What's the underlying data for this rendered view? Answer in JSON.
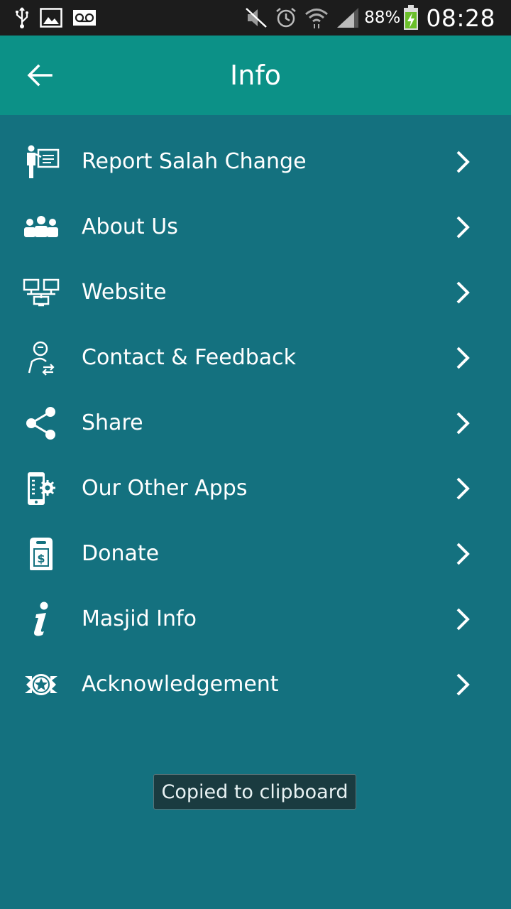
{
  "status_bar": {
    "battery_percent": "88%",
    "time": "08:28"
  },
  "app_bar": {
    "title": "Info",
    "back_icon": "arrow-left-icon"
  },
  "menu": {
    "items": [
      {
        "label": "Report Salah Change",
        "icon": "presenter-board-icon"
      },
      {
        "label": "About Us",
        "icon": "group-people-icon"
      },
      {
        "label": "Website",
        "icon": "network-monitors-icon"
      },
      {
        "label": "Contact & Feedback",
        "icon": "person-exchange-icon"
      },
      {
        "label": "Share",
        "icon": "share-icon"
      },
      {
        "label": "Our Other Apps",
        "icon": "phone-gear-icon"
      },
      {
        "label": "Donate",
        "icon": "donation-box-icon"
      },
      {
        "label": "Masjid Info",
        "icon": "info-icon"
      },
      {
        "label": "Acknowledgement",
        "icon": "star-badge-icon"
      }
    ]
  },
  "toast": {
    "message": "Copied to clipboard"
  },
  "colors": {
    "status_bar": "#1c1c1c",
    "app_bar": "#0c9187",
    "background": "#14717f",
    "toast_bg": "#1a3b40"
  }
}
